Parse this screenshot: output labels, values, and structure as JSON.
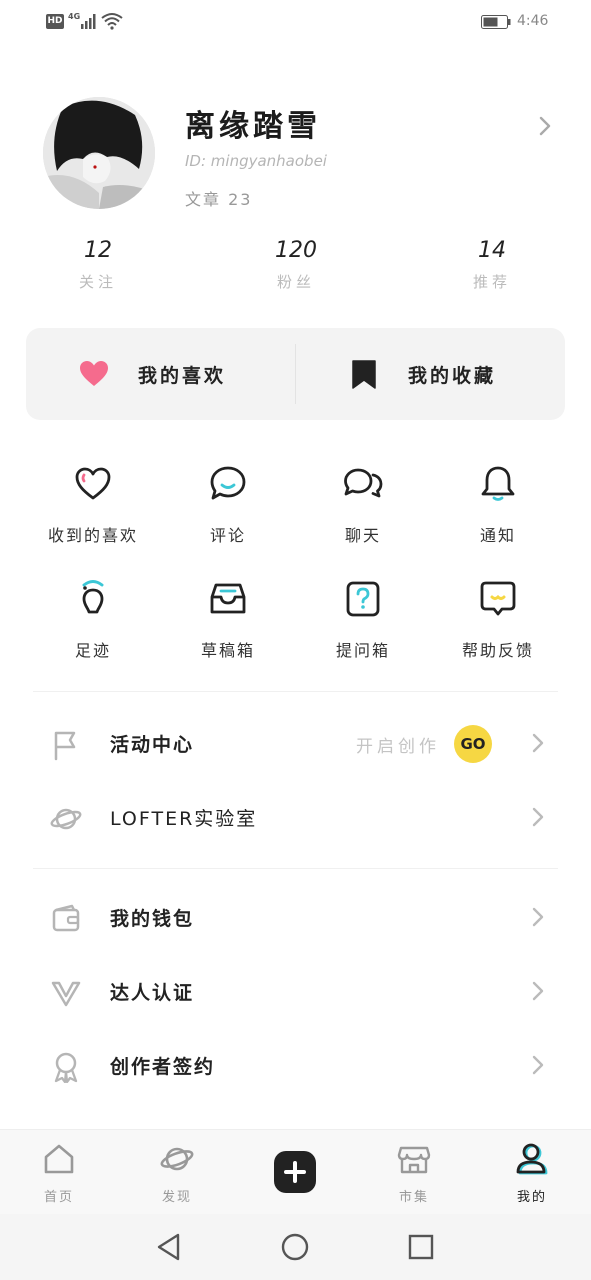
{
  "status_bar": {
    "hd": "HD",
    "network": "4G",
    "time": "4:46"
  },
  "profile": {
    "name": "离缘踏雪",
    "id_text": "ID: mingyanhaobei",
    "articles_text": "文章 23"
  },
  "stats": [
    {
      "value": "12",
      "label": "关注"
    },
    {
      "value": "120",
      "label": "粉丝"
    },
    {
      "value": "14",
      "label": "推荐"
    }
  ],
  "quick_cards": {
    "likes_label": "我的喜欢",
    "favorites_label": "我的收藏",
    "heart_color": "#f56b8d"
  },
  "grid": [
    {
      "label": "收到的喜欢",
      "icon": "heart-outline-icon"
    },
    {
      "label": "评论",
      "icon": "comment-icon"
    },
    {
      "label": "聊天",
      "icon": "chat-icon"
    },
    {
      "label": "通知",
      "icon": "bell-icon"
    },
    {
      "label": "足迹",
      "icon": "footprint-icon"
    },
    {
      "label": "草稿箱",
      "icon": "draft-box-icon"
    },
    {
      "label": "提问箱",
      "icon": "question-box-icon"
    },
    {
      "label": "帮助反馈",
      "icon": "help-feedback-icon"
    }
  ],
  "menu": [
    {
      "label": "活动中心",
      "icon": "flag-icon",
      "hint": "开启创作",
      "badge": "GO"
    },
    {
      "label": "LOFTER实验室",
      "icon": "planet-icon"
    },
    {
      "label": "我的钱包",
      "icon": "wallet-icon"
    },
    {
      "label": "达人认证",
      "icon": "verified-v-icon"
    },
    {
      "label": "创作者签约",
      "icon": "award-ribbon-icon"
    }
  ],
  "tabs": [
    {
      "label": "首页",
      "icon": "home-icon"
    },
    {
      "label": "发现",
      "icon": "discover-planet-icon"
    },
    {
      "label": "",
      "icon": "plus-icon"
    },
    {
      "label": "市集",
      "icon": "store-icon"
    },
    {
      "label": "我的",
      "icon": "profile-icon",
      "active": true
    }
  ],
  "colors": {
    "accent_teal": "#3cc7d6",
    "accent_yellow": "#f6d743",
    "accent_pink": "#f56b8d"
  }
}
